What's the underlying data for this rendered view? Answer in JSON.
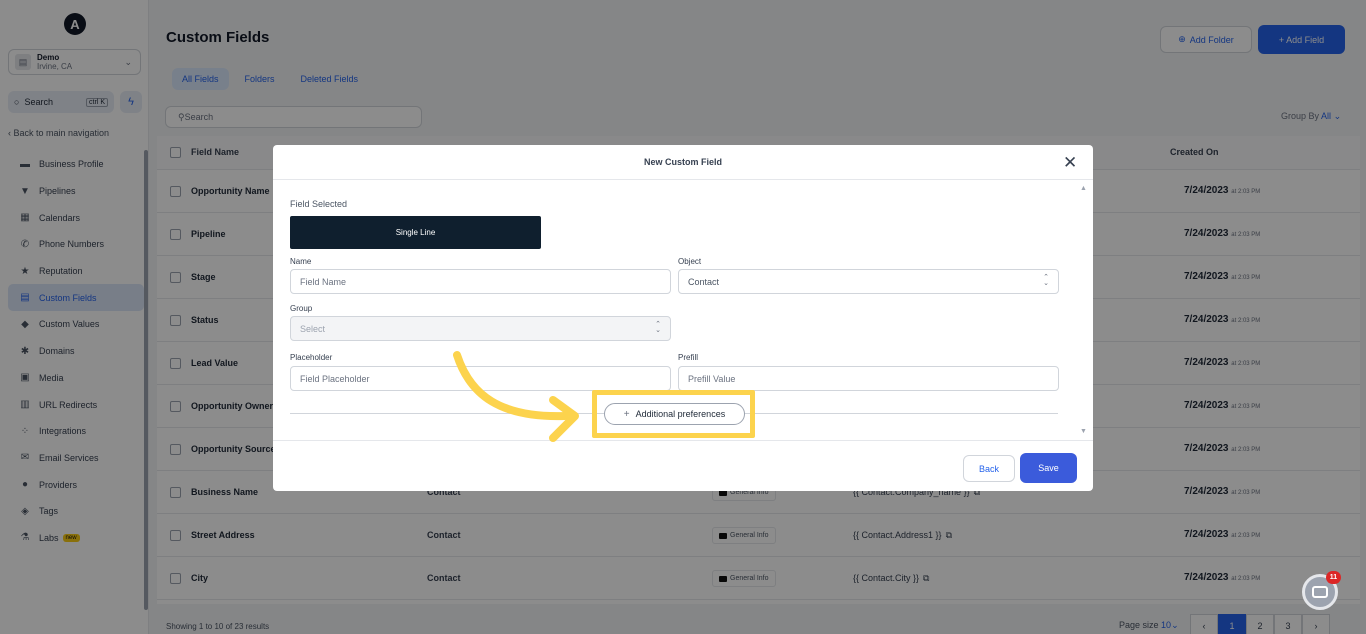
{
  "logo": {
    "letter": "A"
  },
  "account": {
    "name": "Demo",
    "location": "Irvine, CA"
  },
  "sidebar": {
    "search_label": "Search",
    "search_shortcut": "ctrl K",
    "back_label": "Back to main navigation",
    "items": [
      {
        "label": "Business Profile",
        "icon": "briefcase-icon",
        "glyph": "▬"
      },
      {
        "label": "Pipelines",
        "icon": "funnel-icon",
        "glyph": "▼"
      },
      {
        "label": "Calendars",
        "icon": "calendar-icon",
        "glyph": "▦"
      },
      {
        "label": "Phone Numbers",
        "icon": "phone-icon",
        "glyph": "✆"
      },
      {
        "label": "Reputation",
        "icon": "star-icon",
        "glyph": "★"
      },
      {
        "label": "Custom Fields",
        "icon": "fields-icon",
        "glyph": "▤",
        "active": true
      },
      {
        "label": "Custom Values",
        "icon": "diamond-icon",
        "glyph": "◆"
      },
      {
        "label": "Domains",
        "icon": "globe-icon",
        "glyph": "✱"
      },
      {
        "label": "Media",
        "icon": "image-icon",
        "glyph": "▣"
      },
      {
        "label": "URL Redirects",
        "icon": "link-icon",
        "glyph": "▥"
      },
      {
        "label": "Integrations",
        "icon": "puzzle-icon",
        "glyph": "⁘"
      },
      {
        "label": "Email Services",
        "icon": "mail-icon",
        "glyph": "✉"
      },
      {
        "label": "Providers",
        "icon": "user-icon",
        "glyph": "●"
      },
      {
        "label": "Tags",
        "icon": "tag-icon",
        "glyph": "◈"
      },
      {
        "label": "Labs",
        "icon": "flask-icon",
        "glyph": "⚗",
        "badge": "new"
      }
    ]
  },
  "header": {
    "title": "Custom Fields",
    "add_folder": "Add Folder",
    "add_field": "+ Add Field"
  },
  "tabs": [
    "All Fields",
    "Folders",
    "Deleted Fields"
  ],
  "search": {
    "placeholder": "Search"
  },
  "group_by": {
    "label": "Group By",
    "value": "All"
  },
  "table": {
    "col_field_name": "Field Name",
    "col_created_on": "Created On",
    "rows": [
      {
        "name": "Opportunity Name",
        "object": "",
        "folder": "",
        "key": "",
        "date": "7/24/2023",
        "time": "at 2:03 PM"
      },
      {
        "name": "Pipeline",
        "object": "",
        "folder": "",
        "key": "",
        "date": "7/24/2023",
        "time": "at 2:03 PM"
      },
      {
        "name": "Stage",
        "object": "",
        "folder": "",
        "key": "",
        "date": "7/24/2023",
        "time": "at 2:03 PM"
      },
      {
        "name": "Status",
        "object": "",
        "folder": "",
        "key": "",
        "date": "7/24/2023",
        "time": "at 2:03 PM"
      },
      {
        "name": "Lead Value",
        "object": "",
        "folder": "",
        "key": "",
        "date": "7/24/2023",
        "time": "at 2:03 PM"
      },
      {
        "name": "Opportunity Owner",
        "object": "",
        "folder": "",
        "key": "",
        "date": "7/24/2023",
        "time": "at 2:03 PM"
      },
      {
        "name": "Opportunity Source",
        "object": "",
        "folder": "",
        "key": "",
        "date": "7/24/2023",
        "time": "at 2:03 PM"
      },
      {
        "name": "Business Name",
        "object": "Contact",
        "folder": "General Info",
        "key": "{{ Contact.Company_name }}",
        "date": "7/24/2023",
        "time": "at 2:03 PM"
      },
      {
        "name": "Street Address",
        "object": "Contact",
        "folder": "General Info",
        "key": "{{ Contact.Address1 }}",
        "date": "7/24/2023",
        "time": "at 2:03 PM"
      },
      {
        "name": "City",
        "object": "Contact",
        "folder": "General Info",
        "key": "{{ Contact.City }}",
        "date": "7/24/2023",
        "time": "at 2:03 PM"
      }
    ]
  },
  "footer": {
    "showing": "Showing 1 to 10 of 23 results",
    "page_size_label": "Page size",
    "page_size_value": "10",
    "pages": [
      "1",
      "2",
      "3"
    ]
  },
  "modal": {
    "title": "New Custom Field",
    "field_selected_label": "Field Selected",
    "field_selected_value": "Single Line",
    "name_label": "Name",
    "name_placeholder": "Field Name",
    "object_label": "Object",
    "object_value": "Contact",
    "group_label": "Group",
    "group_placeholder": "Select",
    "placeholder_label": "Placeholder",
    "placeholder_placeholder": "Field Placeholder",
    "prefill_label": "Prefill",
    "prefill_placeholder": "Prefill Value",
    "additional_prefs": "Additional preferences",
    "back": "Back",
    "save": "Save"
  },
  "chat": {
    "badge": "11"
  },
  "colors": {
    "accent": "#2563eb",
    "highlight": "#fcd34d",
    "dark_button": "#0f1f2e"
  }
}
